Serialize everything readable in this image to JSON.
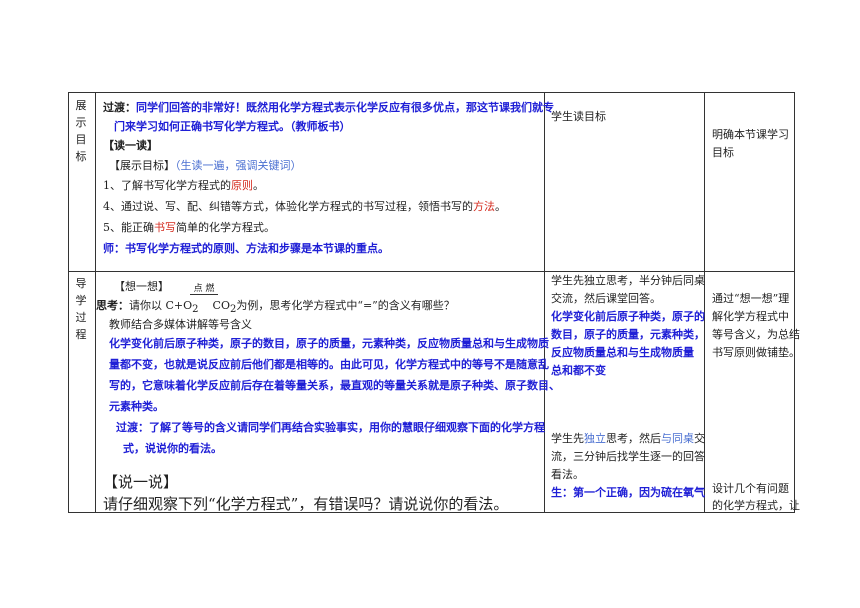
{
  "row1": {
    "label": [
      "展",
      "示",
      "目",
      "标"
    ],
    "teacher": {
      "line1_prefix": "过渡：",
      "line1": "同学们回答的非常好！既然用化学方程式表示化学反应有很多优点，那这节课我们就专",
      "line2": "门来学习如何正确书写化学方程式。（教师板书）",
      "read_title": "【读一读】",
      "goal_prefix": "【展示目标】",
      "goal_note": "（生读一遍，强调关键词）",
      "g1_a": "1、了解书写化学方程式的",
      "g1_b": "原则",
      "g1_c": "。",
      "g2_a": "4、通过说、写、配、纠错等方式，体验化学方程式的书写过程，领悟书写的",
      "g2_b": "方法",
      "g2_c": "。",
      "g3_a": "5、能正确",
      "g3_b": "书写",
      "g3_c": "简单的化学方程式。",
      "key_prefix": "师：",
      "key": "书写化学方程式的原则、方法和步骤是本节课的重点。"
    },
    "student": "学生读目标",
    "intent": [
      "明确本节课学习",
      "目标"
    ]
  },
  "row2": {
    "label": [
      "导",
      "学",
      "过",
      "程"
    ],
    "teacher": {
      "think_title": "【想一想】",
      "condition": "点 燃",
      "think_prefix": "思考：",
      "think_a": "请你以 C+O",
      "think_sub1": "2",
      "think_co2": "CO",
      "think_sub2": "2",
      "think_b": "为例，思考化学方程式中“=”的含义有哪些？",
      "media": "教师结合多媒体讲解等号含义",
      "p1": "化学变化前后原子种类，原子的数目，原子的质量，元素种类，反应物质量总和与生成物质",
      "p2": "量都不变，也就是说反应前后他们都是相等的。由此可见，化学方程式中的等号不是随意乱",
      "p3": "写的，它意味着化学反应前后存在着等量关系，最直观的等量关系就是原子种类、原子数目、",
      "p4": "元素种类。",
      "tr1": "过渡：了解了等号的含义请同学们再结合实验事实，用你的慧眼仔细观察下面的化学方程",
      "tr2": "式，说说你的看法。",
      "say_title": "【说一说】",
      "say_q": "请仔细观察下列“化学方程式”，有错误吗？请说说你的看法。"
    },
    "student": {
      "s1": "学生先独立思考，半分钟后同桌",
      "s2": "交流，然后课堂回答。",
      "a1": "化学变化前后原子种类，原子的",
      "a2": "数目，原子的质量，元素种类，",
      "a3": "反应物质量总和与生成物质量",
      "a4": "总和都不变",
      "b1_a": "学生先",
      "b1_b": "独立",
      "b1_c": "思考，然后",
      "b1_d": "与同桌",
      "b1_e": "交",
      "b2": "流，三分钟后找学生逐一的回答",
      "b3": "看法。",
      "c1": "生：第一个正确，因为硫在氧气"
    },
    "intent": {
      "i1": "通过“想一想”理",
      "i2": "解化学方程式中",
      "i3": "等号含义，为总结",
      "i4": "书写原则做铺垫。",
      "j1": "设计几个有问题",
      "j2": "的化学方程式，让"
    }
  }
}
